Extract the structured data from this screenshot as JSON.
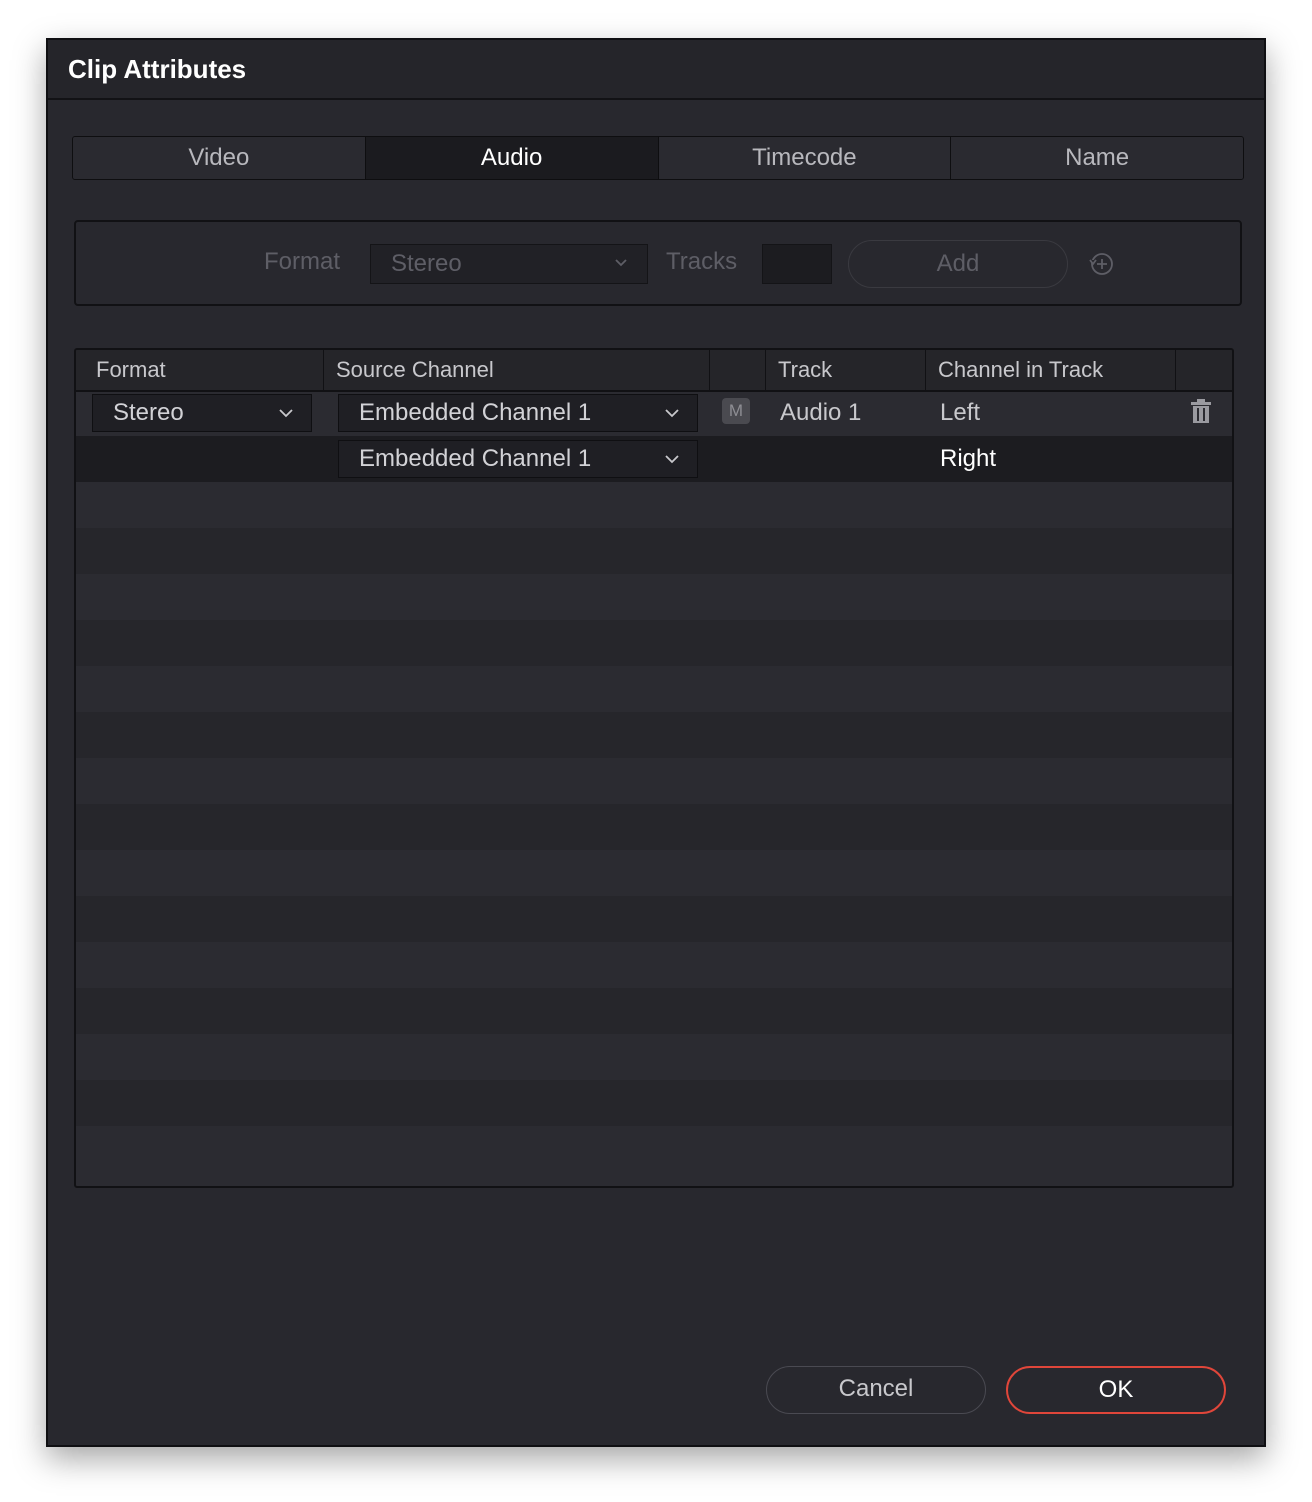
{
  "dialog": {
    "title": "Clip Attributes"
  },
  "tabs": [
    {
      "label": "Video",
      "active": false
    },
    {
      "label": "Audio",
      "active": true
    },
    {
      "label": "Timecode",
      "active": false
    },
    {
      "label": "Name",
      "active": false
    }
  ],
  "add_panel": {
    "format_label": "Format",
    "format_value": "Stereo",
    "tracks_label": "Tracks",
    "tracks_value": "",
    "add_label": "Add",
    "reset_icon": "reset-add-icon"
  },
  "table": {
    "columns": [
      "Format",
      "Source Channel",
      "",
      "Track",
      "Channel in Track",
      ""
    ],
    "rows": [
      {
        "format": "Stereo",
        "source": "Embedded Channel 1",
        "mute": "M",
        "track": "Audio 1",
        "channel": "Left"
      },
      {
        "format": "",
        "source": "Embedded Channel 1",
        "mute": "",
        "track": "",
        "channel": "Right"
      }
    ]
  },
  "footer": {
    "cancel_label": "Cancel",
    "ok_label": "OK"
  },
  "colors": {
    "background": "#28282e",
    "ok_border": "#e0463a",
    "selected_row": "#1c1c20"
  }
}
